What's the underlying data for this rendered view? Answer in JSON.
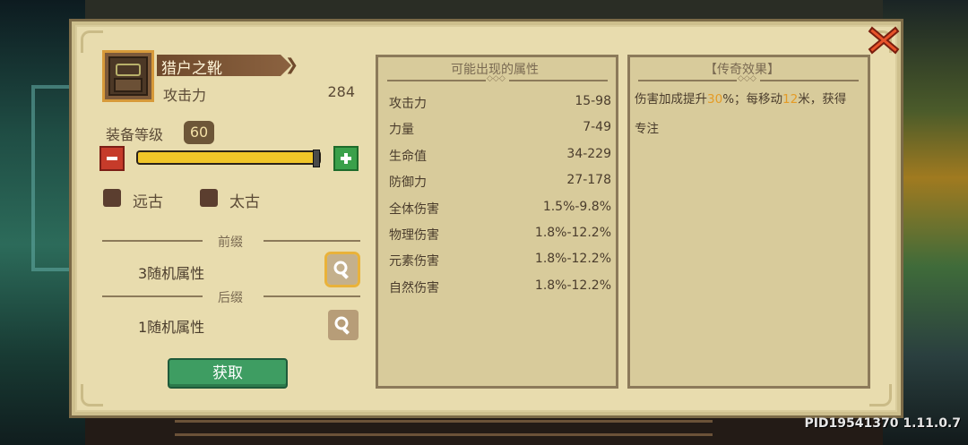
{
  "item": {
    "name": "猎户之靴",
    "stat_label": "攻击力",
    "stat_value": "284",
    "icon": "boots-icon"
  },
  "level": {
    "label": "装备等级",
    "value": "60",
    "slider_fraction": 1.0
  },
  "tiers": {
    "ancient": "远古",
    "primal": "太古"
  },
  "affixes": {
    "prefix_label": "前缀",
    "prefix_text": "3随机属性",
    "suffix_label": "后缀",
    "suffix_text": "1随机属性"
  },
  "actions": {
    "obtain": "获取"
  },
  "possible_attributes": {
    "title": "可能出现的属性",
    "rows": [
      {
        "name": "攻击力",
        "range": "15-98"
      },
      {
        "name": "力量",
        "range": "7-49"
      },
      {
        "name": "生命值",
        "range": "34-229"
      },
      {
        "name": "防御力",
        "range": "27-178"
      },
      {
        "name": "全体伤害",
        "range": "1.5%-9.8%"
      },
      {
        "name": "物理伤害",
        "range": "1.8%-12.2%"
      },
      {
        "name": "元素伤害",
        "range": "1.8%-12.2%"
      },
      {
        "name": "自然伤害",
        "range": "1.8%-12.2%"
      }
    ]
  },
  "legendary": {
    "title": "【传奇效果】",
    "line1_a": "伤害加成提升",
    "line1_b": "30",
    "line1_c": "%；每移动",
    "line1_d": "12",
    "line1_e": "米，获得",
    "line2": "专注"
  },
  "version": "PID19541370 1.11.0.7",
  "colors": {
    "panel": "#e8dcae",
    "highlight": "#e49b26",
    "button_green": "#3e9d62",
    "minus_red": "#c63b2a"
  }
}
